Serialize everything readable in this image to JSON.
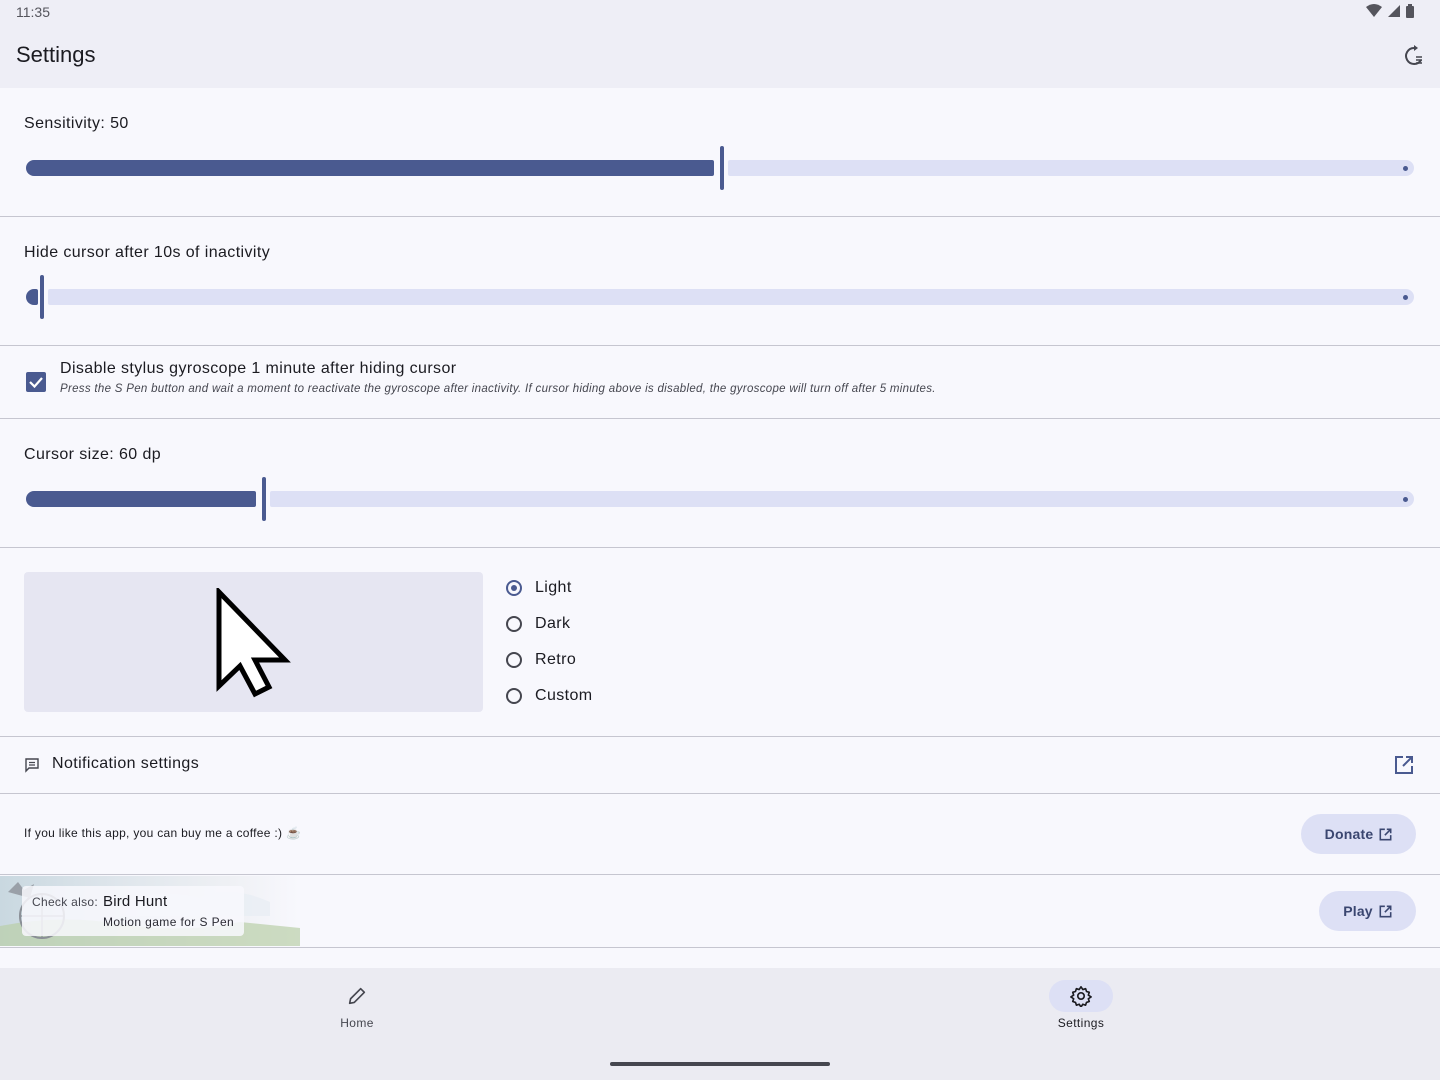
{
  "status_bar": {
    "time": "11:35"
  },
  "app_bar": {
    "title": "Settings",
    "action_icon": "restore-icon"
  },
  "sensitivity": {
    "label": "Sensitivity: 50",
    "value": 50,
    "max": 100
  },
  "hide_cursor": {
    "label": "Hide cursor after 10s of inactivity",
    "fraction": 0.01
  },
  "gyroscope": {
    "checked": true,
    "title": "Disable stylus gyroscope 1 minute after hiding cursor",
    "description": "Press the S Pen button and wait a moment to reactivate the gyroscope after inactivity. If cursor hiding above is disabled, the gyroscope will turn off after 5 minutes."
  },
  "cursor_size": {
    "label": "Cursor size: 60 dp",
    "fraction": 0.17
  },
  "cursor_theme": {
    "options": [
      "Light",
      "Dark",
      "Retro",
      "Custom"
    ],
    "selected": "Light"
  },
  "notification": {
    "label": "Notification settings",
    "icon": "message-icon",
    "action_icon": "open-external-icon"
  },
  "donate": {
    "text": "If you like this app, you can buy me a coffee :) ☕",
    "button": "Donate"
  },
  "bird_hunt": {
    "check_also": "Check also:",
    "title": "Bird Hunt",
    "subtitle": "Motion game for S Pen",
    "button": "Play"
  },
  "bottom_nav": {
    "items": [
      {
        "label": "Home",
        "icon": "pencil-icon"
      },
      {
        "label": "Settings",
        "icon": "gear-icon"
      }
    ],
    "active": "Settings"
  },
  "colors": {
    "primary": "#4a5a90",
    "track_inactive": "#dde0f5",
    "surface": "#f8f8fd",
    "bar": "#eeeef6"
  }
}
